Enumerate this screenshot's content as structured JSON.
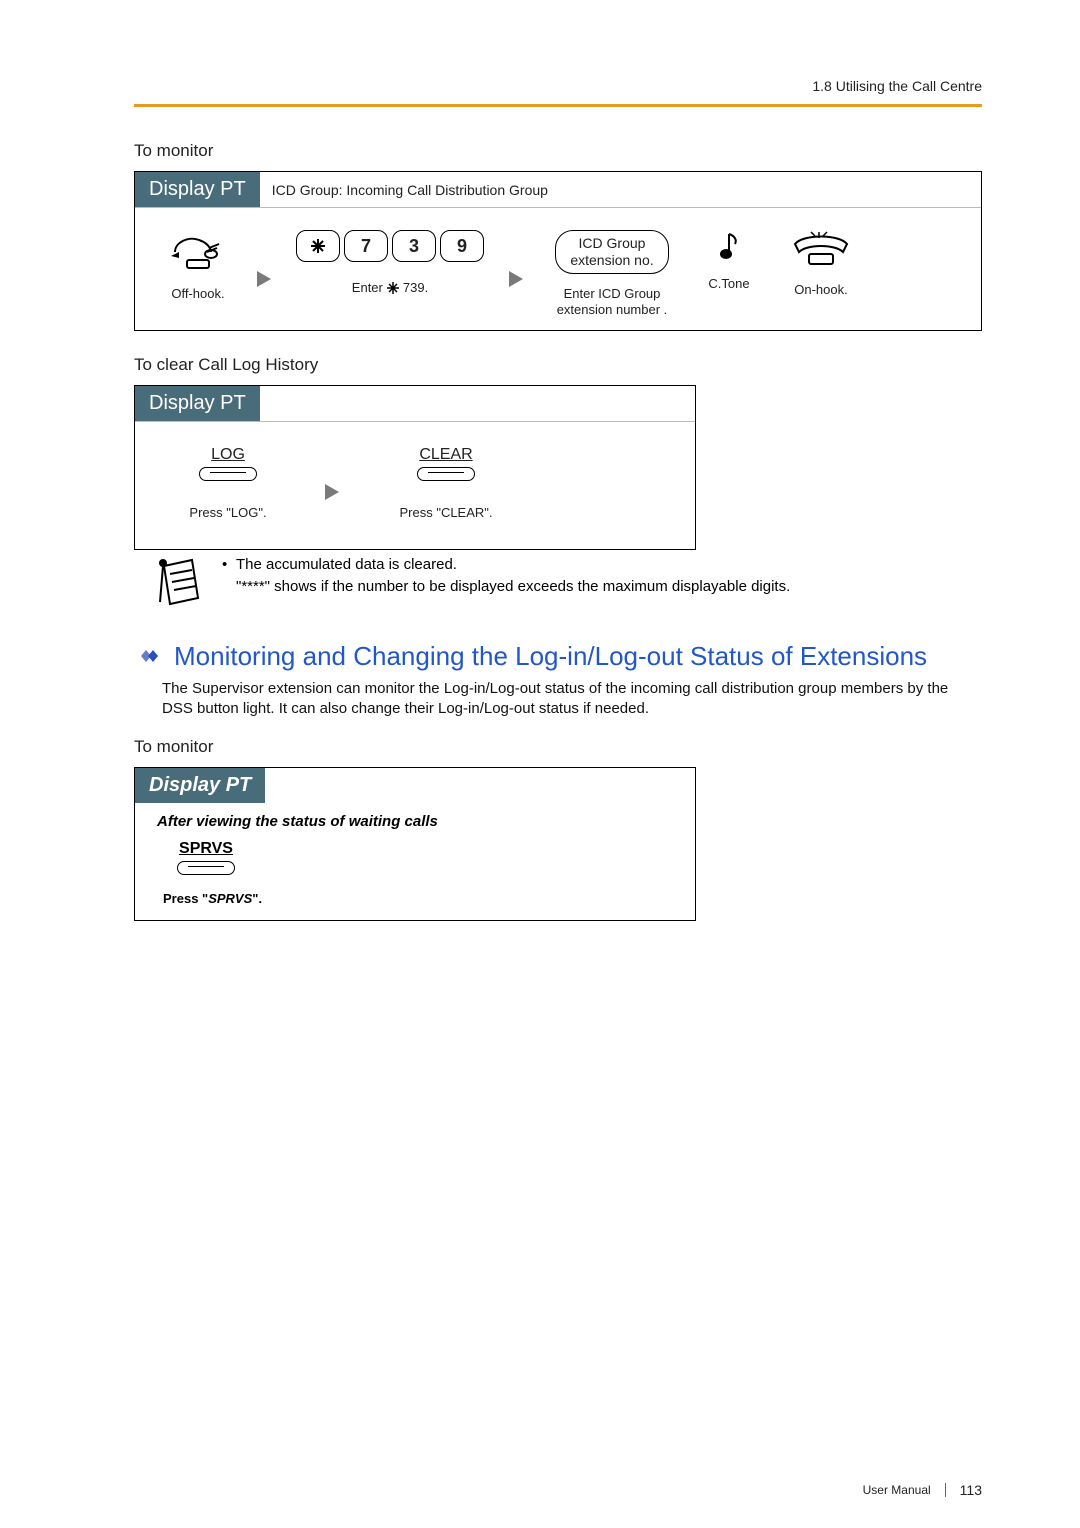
{
  "header": {
    "breadcrumb": "1.8 Utilising the Call Centre"
  },
  "section1": {
    "heading": "To monitor",
    "box_title": "Display PT",
    "box_note": "ICD Group: Incoming Call Distribution Group",
    "steps": {
      "offhook": "Off-hook.",
      "keys": [
        "7",
        "3",
        "9"
      ],
      "enter_code_label": "Enter    739.",
      "icd_line1": "ICD Group",
      "icd_line2": "extension no.",
      "enter_icd_label_l1": "Enter ICD Group",
      "enter_icd_label_l2": "extension number  .",
      "ctone": "C.Tone",
      "onhook": "On-hook."
    }
  },
  "section2": {
    "heading": "To clear Call Log History",
    "box_title": "Display PT",
    "log_label": "LOG",
    "clear_label": "CLEAR",
    "press_log": "Press \"LOG\".",
    "press_clear": "Press \"CLEAR\"."
  },
  "notes": {
    "line1": "The accumulated data is cleared.",
    "line2": "\"****\" shows if the number to be displayed exceeds the maximum displayable digits."
  },
  "section3": {
    "title": "Monitoring and Changing the Log-in/Log-out Status of Extensions",
    "para": "The Supervisor extension can monitor the Log-in/Log-out status of the incoming call distribution group members by the DSS button light. It can also change their Log-in/Log-out status if needed."
  },
  "section4": {
    "heading": "To monitor",
    "box_title": "Display PT",
    "after": "After viewing the status of waiting calls",
    "sprvs": "SPRVS",
    "press_pre": "Press \"",
    "press_em": "SPRVS",
    "press_post": "\"."
  },
  "footer": {
    "manual": "User Manual",
    "page": "113"
  }
}
